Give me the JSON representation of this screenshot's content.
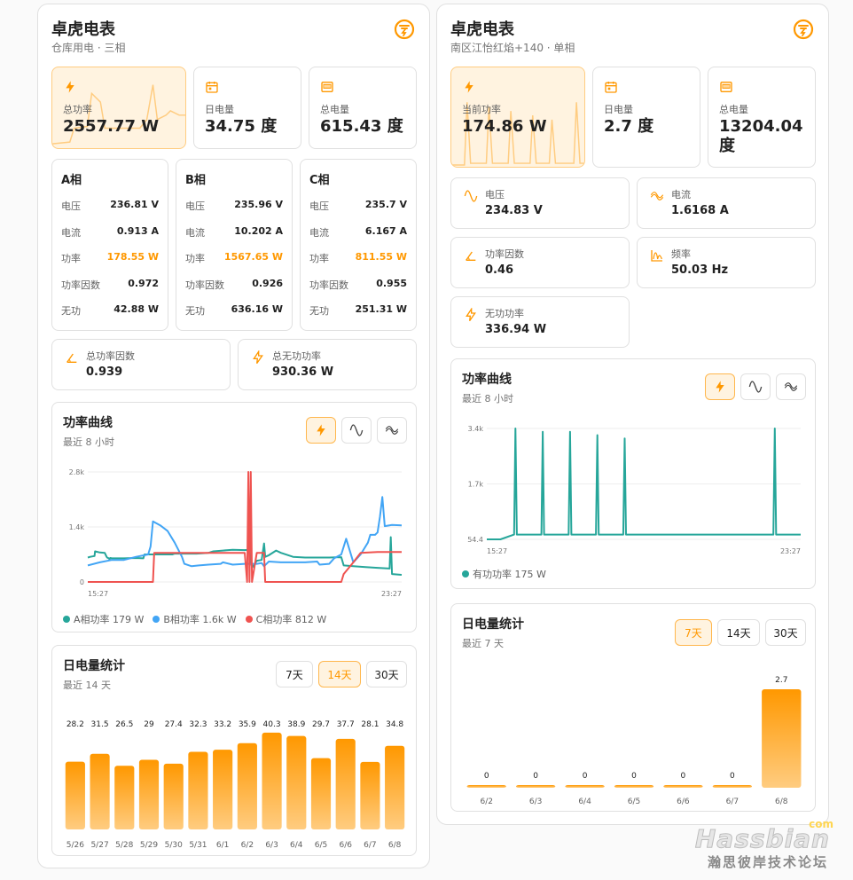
{
  "colors": {
    "accent": "#ff9800",
    "teal": "#26a69a",
    "blue": "#42a5f5",
    "red": "#ef5350"
  },
  "card1": {
    "title": "卓虎电表",
    "subtitle": "仓库用电 · 三相",
    "stats": [
      {
        "icon": "lightning-icon",
        "label": "总功率",
        "value": "2557.77 W"
      },
      {
        "icon": "calendar-icon",
        "label": "日电量",
        "value": "34.75 度"
      },
      {
        "icon": "meter-icon",
        "label": "总电量",
        "value": "615.43 度"
      }
    ],
    "phases": [
      {
        "title": "A相",
        "rows": [
          {
            "k": "电压",
            "v": "236.81 V"
          },
          {
            "k": "电流",
            "v": "0.913 A"
          },
          {
            "k": "功率",
            "v": "178.55 W"
          },
          {
            "k": "功率因数",
            "v": "0.972"
          },
          {
            "k": "无功",
            "v": "42.88 W"
          }
        ]
      },
      {
        "title": "B相",
        "rows": [
          {
            "k": "电压",
            "v": "235.96 V"
          },
          {
            "k": "电流",
            "v": "10.202 A"
          },
          {
            "k": "功率",
            "v": "1567.65 W"
          },
          {
            "k": "功率因数",
            "v": "0.926"
          },
          {
            "k": "无功",
            "v": "636.16 W"
          }
        ]
      },
      {
        "title": "C相",
        "rows": [
          {
            "k": "电压",
            "v": "235.7 V"
          },
          {
            "k": "电流",
            "v": "6.167 A"
          },
          {
            "k": "功率",
            "v": "811.55 W"
          },
          {
            "k": "功率因数",
            "v": "0.955"
          },
          {
            "k": "无功",
            "v": "251.31 W"
          }
        ]
      }
    ],
    "pf": {
      "icon": "angle-icon",
      "label": "总功率因数",
      "value": "0.939"
    },
    "reactive": {
      "icon": "lightning-icon",
      "label": "总无功功率",
      "value": "930.36 W"
    },
    "power_curve": {
      "title": "功率曲线",
      "subtitle": "最近 8 小时"
    },
    "daily": {
      "title": "日电量统计",
      "subtitle": "最近 14 天",
      "buttons": [
        "7天",
        "14天",
        "30天"
      ],
      "active": 1
    }
  },
  "card2": {
    "title": "卓虎电表",
    "subtitle": "南区江怡红焰+140 · 单相",
    "stats": [
      {
        "icon": "lightning-icon",
        "label": "当前功率",
        "value": "174.86 W"
      },
      {
        "icon": "calendar-icon",
        "label": "日电量",
        "value": "2.7 度"
      },
      {
        "icon": "meter-icon",
        "label": "总电量",
        "value": "13204.04 度"
      }
    ],
    "minis": [
      {
        "icon": "sine-wave-icon",
        "label": "电压",
        "value": "234.83 V"
      },
      {
        "icon": "current-wave-icon",
        "label": "电流",
        "value": "1.6168 A"
      },
      {
        "icon": "angle-icon",
        "label": "功率因数",
        "value": "0.46"
      },
      {
        "icon": "frequency-icon",
        "label": "频率",
        "value": "50.03 Hz"
      },
      {
        "icon": "lightning-icon",
        "label": "无功功率",
        "value": "336.94 W"
      }
    ],
    "power_curve": {
      "title": "功率曲线",
      "subtitle": "最近 8 小时"
    },
    "daily": {
      "title": "日电量统计",
      "subtitle": "最近 7 天",
      "buttons": [
        "7天",
        "14天",
        "30天"
      ],
      "active": 0
    }
  },
  "watermark": {
    "brand": "Hassbian",
    "com": "com",
    "cn": "瀚思彼岸技术论坛"
  },
  "chart_data": [
    {
      "type": "line",
      "title": "功率曲线",
      "ylim": [
        0,
        2800
      ],
      "yticks": [
        "0",
        "1.4k",
        "2.8k"
      ],
      "xticks": [
        "15:27",
        "23:27"
      ],
      "series": [
        {
          "name": "A相功率",
          "legend": "A相功率 179 W",
          "color": "#26a69a",
          "points": [
            [
              0,
              620
            ],
            [
              0.1,
              640
            ],
            [
              0.2,
              650
            ],
            [
              0.28,
              660
            ],
            [
              0.3,
              780
            ],
            [
              0.5,
              750
            ],
            [
              0.7,
              740
            ],
            [
              0.77,
              650
            ],
            [
              0.8,
              620
            ],
            [
              0.87,
              600
            ],
            [
              0.9,
              580
            ],
            [
              0.93,
              610
            ],
            [
              1.0,
              600
            ],
            [
              1.5,
              600
            ],
            [
              2.0,
              610
            ],
            [
              2.3,
              600
            ],
            [
              2.35,
              700
            ],
            [
              2.5,
              700
            ],
            [
              3.0,
              700
            ],
            [
              3.5,
              700
            ],
            [
              3.6,
              720
            ],
            [
              4.0,
              720
            ],
            [
              4.5,
              720
            ],
            [
              5.0,
              740
            ],
            [
              5.2,
              780
            ],
            [
              5.6,
              800
            ],
            [
              6.0,
              820
            ],
            [
              6.5,
              810
            ],
            [
              6.7,
              820
            ],
            [
              6.8,
              360
            ],
            [
              7.0,
              540
            ],
            [
              7.2,
              560
            ],
            [
              7.3,
              980
            ],
            [
              7.35,
              640
            ],
            [
              7.5,
              680
            ],
            [
              7.8,
              800
            ],
            [
              8.0,
              740
            ],
            [
              8.5,
              640
            ],
            [
              9.0,
              620
            ],
            [
              10.0,
              620
            ],
            [
              10.5,
              630
            ],
            [
              10.6,
              420
            ],
            [
              11.0,
              400
            ],
            [
              11.5,
              380
            ],
            [
              12.0,
              360
            ],
            [
              12.5,
              340
            ],
            [
              12.55,
              1140
            ],
            [
              12.6,
              200
            ],
            [
              13.0,
              180
            ]
          ]
        },
        {
          "name": "B相功率",
          "legend": "B相功率 1.6k W",
          "color": "#42a5f5",
          "points": [
            [
              0,
              420
            ],
            [
              0.5,
              500
            ],
            [
              1.0,
              560
            ],
            [
              1.5,
              560
            ],
            [
              2.0,
              640
            ],
            [
              2.5,
              700
            ],
            [
              2.6,
              900
            ],
            [
              2.7,
              1540
            ],
            [
              3.0,
              1440
            ],
            [
              3.3,
              1300
            ],
            [
              3.6,
              1000
            ],
            [
              3.9,
              640
            ],
            [
              4.0,
              460
            ],
            [
              4.3,
              400
            ],
            [
              4.6,
              420
            ],
            [
              5.0,
              440
            ],
            [
              5.5,
              460
            ],
            [
              5.6,
              500
            ],
            [
              6.0,
              440
            ],
            [
              6.5,
              460
            ],
            [
              7.0,
              460
            ],
            [
              7.2,
              480
            ],
            [
              7.3,
              400
            ],
            [
              7.5,
              520
            ],
            [
              8.0,
              500
            ],
            [
              8.5,
              500
            ],
            [
              9.0,
              500
            ],
            [
              9.5,
              520
            ],
            [
              9.6,
              440
            ],
            [
              10.0,
              460
            ],
            [
              10.2,
              600
            ],
            [
              10.5,
              700
            ],
            [
              10.7,
              1100
            ],
            [
              11.0,
              500
            ],
            [
              11.3,
              700
            ],
            [
              11.6,
              1000
            ],
            [
              11.7,
              1200
            ],
            [
              11.9,
              1200
            ],
            [
              12.0,
              1260
            ],
            [
              12.1,
              1660
            ],
            [
              12.2,
              2160
            ],
            [
              12.3,
              1420
            ],
            [
              12.6,
              1450
            ],
            [
              13.0,
              1440
            ]
          ]
        },
        {
          "name": "C相功率",
          "legend": "C相功率 812 W",
          "color": "#ef5350",
          "points": [
            [
              0,
              0
            ],
            [
              0.5,
              0
            ],
            [
              1.0,
              0
            ],
            [
              1.5,
              0
            ],
            [
              2.0,
              0
            ],
            [
              2.5,
              0
            ],
            [
              2.7,
              0
            ],
            [
              2.75,
              740
            ],
            [
              3.0,
              740
            ],
            [
              4.0,
              740
            ],
            [
              5.0,
              740
            ],
            [
              6.0,
              740
            ],
            [
              6.5,
              740
            ],
            [
              6.6,
              0
            ],
            [
              6.65,
              2800
            ],
            [
              6.7,
              0
            ],
            [
              6.75,
              2800
            ],
            [
              6.8,
              0
            ],
            [
              7.0,
              740
            ],
            [
              7.3,
              740
            ],
            [
              7.35,
              0
            ],
            [
              8.0,
              0
            ],
            [
              9.0,
              0
            ],
            [
              10.0,
              0
            ],
            [
              10.5,
              0
            ],
            [
              10.6,
              200
            ],
            [
              11.0,
              500
            ],
            [
              11.3,
              740
            ],
            [
              12.0,
              760
            ],
            [
              13.0,
              760
            ]
          ]
        }
      ]
    },
    {
      "type": "bar",
      "title": "日电量统计",
      "categories": [
        "5/26",
        "5/27",
        "5/28",
        "5/29",
        "5/30",
        "5/31",
        "6/1",
        "6/2",
        "6/3",
        "6/4",
        "6/5",
        "6/6",
        "6/7",
        "6/8"
      ],
      "values": [
        28.2,
        31.5,
        26.5,
        29,
        27.4,
        32.3,
        33.2,
        35.9,
        40.3,
        38.9,
        29.7,
        37.7,
        28.1,
        34.8
      ],
      "labels": [
        "28.2",
        "31.5",
        "26.5",
        "29",
        "27.4",
        "32.3",
        "33.2",
        "35.9",
        "40.3",
        "38.9",
        "29.7",
        "37.7",
        "28.1",
        "34.8"
      ],
      "ylim": [
        0,
        41
      ]
    },
    {
      "type": "line",
      "title": "功率曲线",
      "ylim": [
        54.4,
        3400
      ],
      "yticks": [
        "54.4",
        "1.7k",
        "3.4k"
      ],
      "xticks": [
        "15:27",
        "23:27"
      ],
      "series": [
        {
          "name": "有功功率",
          "legend": "有功功率 175 W",
          "color": "#26a69a",
          "points": [
            [
              0,
              54.4
            ],
            [
              0.5,
              54.4
            ],
            [
              1.0,
              200
            ],
            [
              1.05,
              3400
            ],
            [
              1.1,
              200
            ],
            [
              2.0,
              200
            ],
            [
              2.05,
              3300
            ],
            [
              2.1,
              200
            ],
            [
              3.0,
              200
            ],
            [
              3.05,
              3300
            ],
            [
              3.1,
              200
            ],
            [
              4.0,
              200
            ],
            [
              4.05,
              3200
            ],
            [
              4.1,
              200
            ],
            [
              5.0,
              200
            ],
            [
              5.05,
              3100
            ],
            [
              5.1,
              200
            ],
            [
              6.0,
              200
            ],
            [
              6.05,
              200
            ],
            [
              10.5,
              200
            ],
            [
              10.55,
              3400
            ],
            [
              10.6,
              200
            ],
            [
              11.5,
              200
            ]
          ]
        }
      ]
    },
    {
      "type": "bar",
      "title": "日电量统计",
      "categories": [
        "6/2",
        "6/3",
        "6/4",
        "6/5",
        "6/6",
        "6/7",
        "6/8"
      ],
      "values": [
        0,
        0,
        0,
        0,
        0,
        0,
        2.7
      ],
      "labels": [
        "0",
        "0",
        "0",
        "0",
        "0",
        "0",
        "2.7"
      ],
      "ylim": [
        0,
        2.7
      ]
    }
  ]
}
